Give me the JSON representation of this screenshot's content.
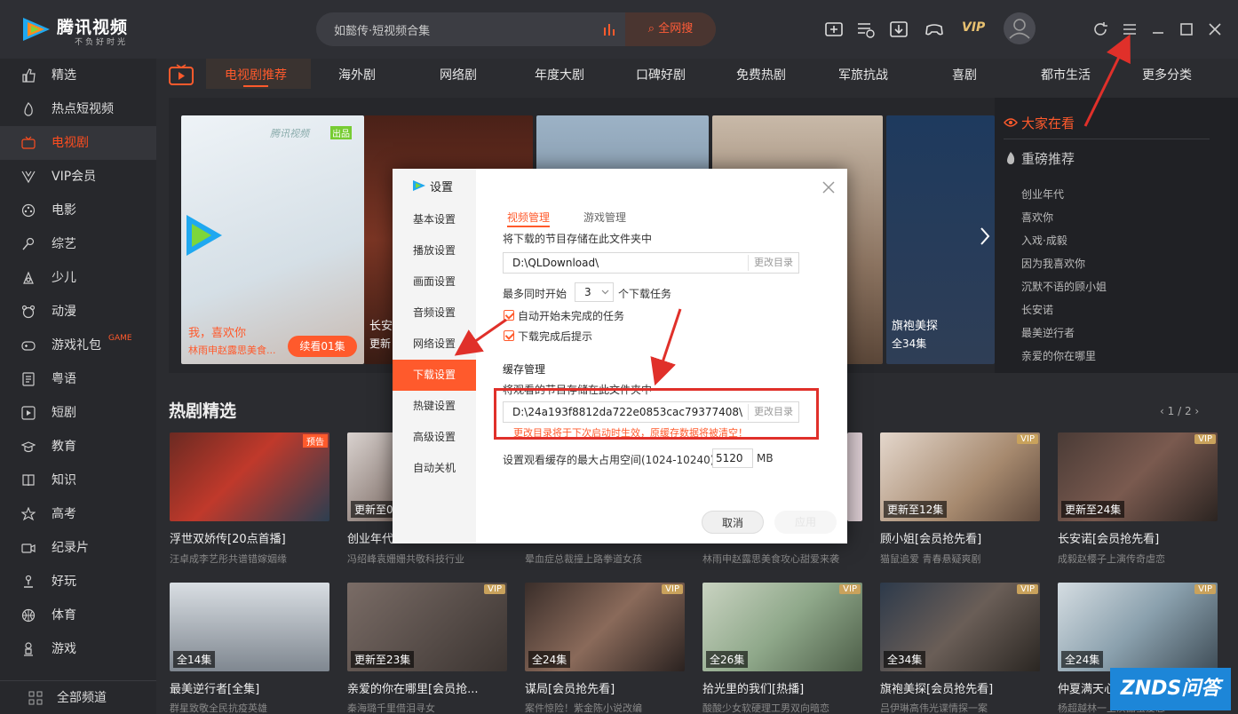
{
  "app": {
    "name": "腾讯视频",
    "slogan": "不负好时光"
  },
  "search": {
    "query": "如懿传·短视频合集",
    "button": "全网搜"
  },
  "header": {
    "vip": "VIP"
  },
  "colors": {
    "accent": "#ff5a2c",
    "background": "#2b2c30",
    "sidebar": "#27282c",
    "annotation_red": "#e0302a"
  },
  "sidebar": {
    "items": [
      {
        "label": "精选",
        "icon": "thumbs-up-icon"
      },
      {
        "label": "热点短视频",
        "icon": "fire-icon"
      },
      {
        "label": "电视剧",
        "icon": "tv-icon",
        "active": true
      },
      {
        "label": "VIP会员",
        "icon": "vip-icon"
      },
      {
        "label": "电影",
        "icon": "film-reel-icon"
      },
      {
        "label": "综艺",
        "icon": "microphone-icon"
      },
      {
        "label": "少儿",
        "icon": "kids-icon"
      },
      {
        "label": "动漫",
        "icon": "bear-icon"
      },
      {
        "label": "游戏礼包",
        "icon": "gamepad-icon",
        "tag": "GAME"
      },
      {
        "label": "粤语",
        "icon": "document-icon"
      },
      {
        "label": "短剧",
        "icon": "play-square-icon"
      },
      {
        "label": "教育",
        "icon": "graduation-icon"
      },
      {
        "label": "知识",
        "icon": "book-icon"
      },
      {
        "label": "高考",
        "icon": "star-cap-icon"
      },
      {
        "label": "纪录片",
        "icon": "camera-icon"
      },
      {
        "label": "好玩",
        "icon": "joystick-icon"
      },
      {
        "label": "体育",
        "icon": "basketball-icon"
      },
      {
        "label": "游戏",
        "icon": "person-icon"
      }
    ],
    "all_channels": "全部频道"
  },
  "tabs": [
    "电视剧推荐",
    "海外剧",
    "网络剧",
    "年度大剧",
    "口碑好剧",
    "免费热剧",
    "军旅抗战",
    "喜剧",
    "都市生活",
    "更多分类"
  ],
  "banner": {
    "left_poster": {
      "line1": "我，喜欢你",
      "line2": "林雨申赵露思美食...",
      "button": "续看01集",
      "watermark": "腾讯视频",
      "watermark_tag": "出品"
    },
    "posters": [
      {
        "title": "长安诺",
        "badge": "更新"
      },
      {
        "title": ""
      },
      {
        "title": ""
      },
      {
        "title": "旗袍美探",
        "badge": "全34集"
      }
    ]
  },
  "right_panel": {
    "heading1": "大家在看",
    "heading2": "重磅推荐",
    "items": [
      "创业年代",
      "喜欢你",
      "入戏·成毅",
      "因为我喜欢你",
      "沉默不语的顾小姐",
      "长安诺",
      "最美逆行者",
      "亲爱的你在哪里"
    ]
  },
  "section": {
    "title": "热剧精选",
    "pager": "1 / 2"
  },
  "row1": [
    {
      "title": "浮世双娇传[20点首播]",
      "sub": "汪卓成李艺彤共谱错嫁姻缘",
      "tag": "预告"
    },
    {
      "title": "创业年代",
      "sub": "冯绍峰袁姗姗共敬科技行业",
      "badge": "更新至0"
    },
    {
      "title": "",
      "sub": "晕血症总裁撞上路拳道女孩"
    },
    {
      "title": "",
      "sub": "林雨申赵露思美食攻心甜爱来袭"
    },
    {
      "title": "顾小姐[会员抢先看]",
      "sub": "猫鼠追爱 青春悬疑爽剧",
      "badge": "更新至12集",
      "vip": "VIP"
    },
    {
      "title": "长安诺[会员抢先看]",
      "sub": "成毅赵樱子上演传奇虐恋",
      "badge": "更新至24集",
      "vip": "VIP"
    }
  ],
  "row2": [
    {
      "title": "最美逆行者[全集]",
      "sub": "群星致敬全民抗疫英雄",
      "badge": "全14集"
    },
    {
      "title": "亲爱的你在哪里[会员抢...",
      "sub": "秦海璐千里借泪寻女",
      "badge": "更新至23集",
      "vip": "VIP"
    },
    {
      "title": "谋局[会员抢先看]",
      "sub": "案件惊险！紫金陈小说改编",
      "badge": "全24集",
      "vip": "VIP"
    },
    {
      "title": "拾光里的我们[热播]",
      "sub": "酸酸少女软硬理工男双向暗恋",
      "badge": "全26集",
      "vip": "VIP"
    },
    {
      "title": "旗袍美探[会员抢先看]",
      "sub": "吕伊琳高伟光谍情探一案",
      "badge": "全34集",
      "vip": "VIP"
    },
    {
      "title": "仲夏满天心",
      "sub": "杨超越林一上演甜蜜爱恋",
      "badge": "全24集",
      "vip": "VIP"
    }
  ],
  "dialog": {
    "title": "设置",
    "menu": [
      "基本设置",
      "播放设置",
      "画面设置",
      "音频设置",
      "网络设置",
      "下载设置",
      "热键设置",
      "高级设置",
      "自动关机"
    ],
    "active_menu": "下载设置",
    "tabs": [
      "视频管理",
      "游戏管理"
    ],
    "download_label": "将下载的节目存储在此文件夹中",
    "download_path": "D:\\QLDownload\\",
    "change_dir": "更改目录",
    "max_prefix": "最多同时开始",
    "max_value": "3",
    "max_suffix": "个下载任务",
    "check1": "自动开始未完成的任务",
    "check2": "下载完成后提示",
    "cache_title": "缓存管理",
    "cache_label": "将观看的节目存储在此文件夹中",
    "cache_path": "D:\\24a193f8812da722e0853cac79377408\\",
    "cache_warning": "更改目录将于下次启动时生效，原缓存数据将被清空！",
    "cache_size_label": "设置观看缓存的最大占用空间(1024-10240)",
    "cache_size_value": "5120",
    "cache_size_unit": "MB",
    "cancel": "取消",
    "apply": "应用"
  },
  "watermark": "ZNDS问答"
}
